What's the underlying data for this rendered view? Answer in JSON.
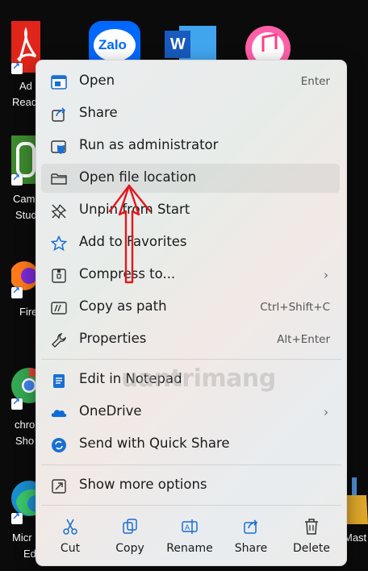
{
  "desktop": {
    "icons": [
      {
        "label_1": "Ad",
        "label_2": "Read"
      },
      {
        "label_1": "Cam",
        "label_2": "Stud"
      },
      {
        "label_1": "Fire"
      },
      {
        "label_1": "chro",
        "label_2": "Sho"
      },
      {
        "label_1": "Micr",
        "label_2": "Ed"
      },
      {
        "label_1": "Mast"
      }
    ],
    "top_icons": [
      {
        "name": "Zalo",
        "text": "Zalo"
      },
      {
        "name": "Word",
        "text": "W"
      },
      {
        "name": "iTunes"
      }
    ]
  },
  "menu": {
    "items": [
      {
        "label": "Open",
        "shortcut": "Enter"
      },
      {
        "label": "Share"
      },
      {
        "label": "Run as administrator"
      },
      {
        "label": "Open file location"
      },
      {
        "label": "Unpin from Start"
      },
      {
        "label": "Add to Favorites"
      },
      {
        "label": "Compress to...",
        "chevron": "›"
      },
      {
        "label": "Copy as path",
        "shortcut": "Ctrl+Shift+C"
      },
      {
        "label": "Properties",
        "shortcut": "Alt+Enter"
      },
      {
        "label": "Edit in Notepad"
      },
      {
        "label": "OneDrive",
        "chevron": "›"
      },
      {
        "label": "Send with Quick Share"
      },
      {
        "label": "Show more options"
      }
    ],
    "actions": [
      {
        "label": "Cut"
      },
      {
        "label": "Copy"
      },
      {
        "label": "Rename"
      },
      {
        "label": "Share"
      },
      {
        "label": "Delete"
      }
    ]
  },
  "watermark": "uantrimang",
  "colors": {
    "accent": "#1a6fd0",
    "annotation": "#e0191e",
    "menu_bg": "#ecedee"
  }
}
